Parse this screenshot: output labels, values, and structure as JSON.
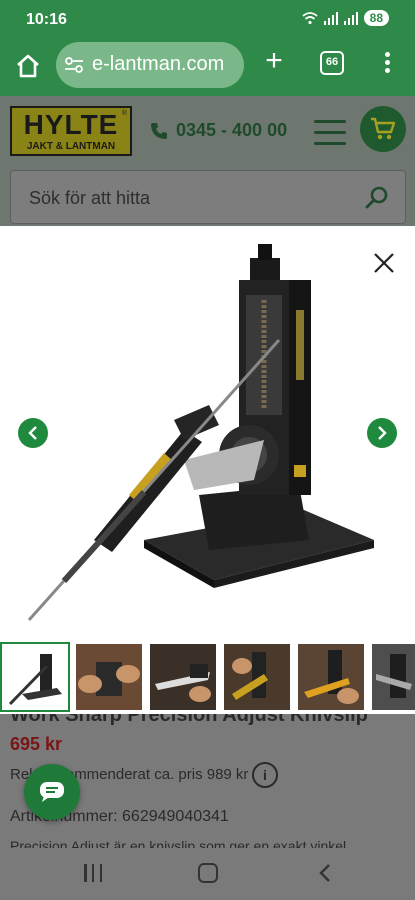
{
  "status": {
    "time": "10:16",
    "battery": "88"
  },
  "browser": {
    "url": "e-lantman.com",
    "tab_count": "66"
  },
  "header": {
    "logo_main": "HYLTE",
    "logo_reg": "®",
    "logo_sub": "JAKT & LANTMAN",
    "phone": "0345 - 400 00",
    "search_placeholder": "Sök för att hitta"
  },
  "product": {
    "title": "Work Sharp Precision Adjust Knivslip",
    "price": "695 kr",
    "ref_price": "Rek. rekommenderat ca. pris 989 kr",
    "info": "i",
    "article": "Artikelnummer: 662949040341",
    "desc": "Precision Adjust är en knivslip som ger en exakt vinkel"
  },
  "gallery": {
    "thumbnail_count": 6,
    "active_index": 0
  },
  "colors": {
    "brand_green": "#2f8a4a",
    "price_red": "#7a1515",
    "logo_yellow": "#8a8416"
  }
}
